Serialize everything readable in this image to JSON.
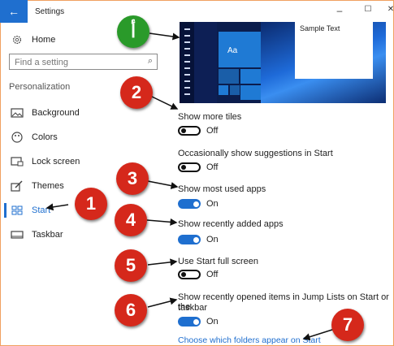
{
  "window": {
    "title": "Settings",
    "back_glyph": "←",
    "minimize_glyph": "–",
    "maximize_glyph": "☐",
    "close_glyph": "✕"
  },
  "sidebar": {
    "home_label": "Home",
    "search_placeholder": "Find a setting",
    "section_label": "Personalization",
    "items": [
      {
        "label": "Background",
        "icon": "image-icon"
      },
      {
        "label": "Colors",
        "icon": "palette-icon"
      },
      {
        "label": "Lock screen",
        "icon": "lock-screen-icon"
      },
      {
        "label": "Themes",
        "icon": "brush-icon"
      },
      {
        "label": "Start",
        "icon": "start-icon",
        "active": true
      },
      {
        "label": "Taskbar",
        "icon": "taskbar-icon"
      }
    ]
  },
  "preview": {
    "tile_label": "Aa",
    "sample_text": "Sample Text"
  },
  "settings": [
    {
      "label": "Show more tiles",
      "state": "Off",
      "on": false
    },
    {
      "label": "Occasionally show suggestions in Start",
      "state": "Off",
      "on": false
    },
    {
      "label": "Show most used apps",
      "state": "On",
      "on": true
    },
    {
      "label": "Show recently added apps",
      "state": "On",
      "on": true
    },
    {
      "label": "Use Start full screen",
      "state": "Off",
      "on": false
    },
    {
      "label_line1": "Show recently opened items in Jump Lists on Start or the",
      "label_line2": "taskbar",
      "state": "On",
      "on": true
    }
  ],
  "link": "Choose which folders appear on Start",
  "markers": [
    "أ",
    "1",
    "2",
    "3",
    "4",
    "5",
    "6",
    "7"
  ],
  "colors": {
    "accent": "#1f6fcf",
    "marker_red": "#d5281b",
    "marker_green": "#2a9a2a"
  }
}
